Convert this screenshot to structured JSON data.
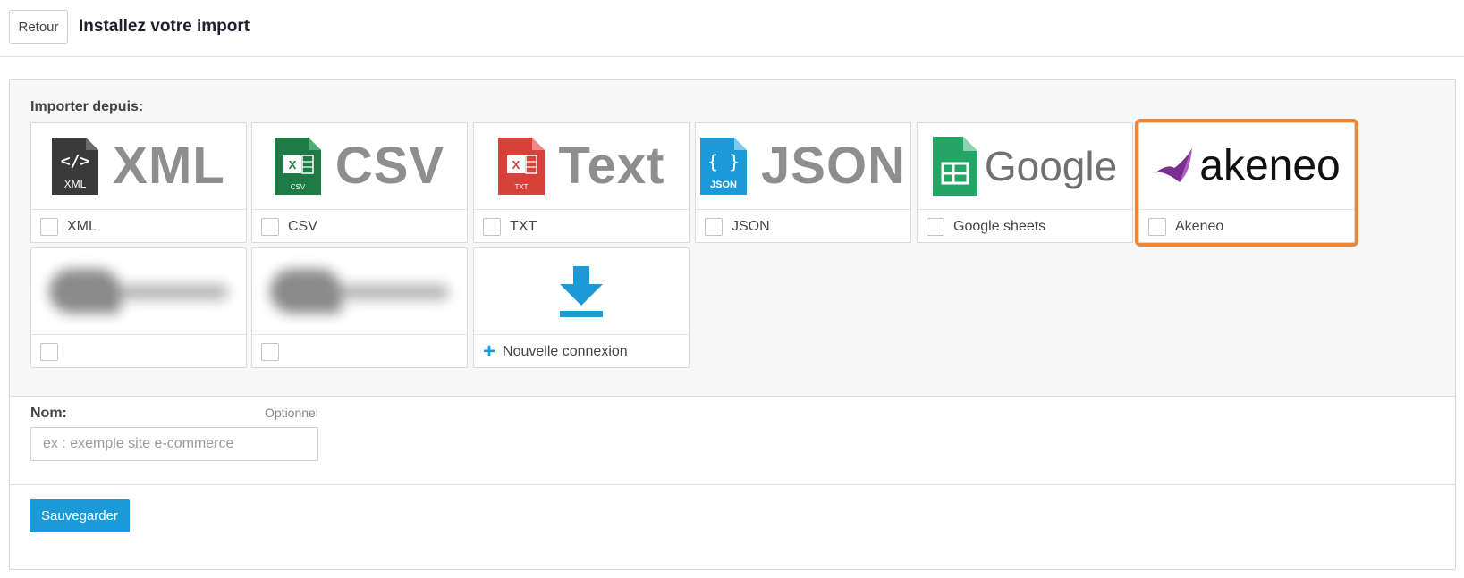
{
  "header": {
    "back_label": "Retour",
    "title": "Installez votre import"
  },
  "sources": {
    "label": "Importer depuis:",
    "cards": [
      {
        "logo_text": "XML",
        "icon_caption": "XML",
        "label": "XML",
        "icon": "xml-file-icon"
      },
      {
        "logo_text": "CSV",
        "icon_caption": "CSV",
        "label": "CSV",
        "icon": "csv-file-icon"
      },
      {
        "logo_text": "Text",
        "icon_caption": "TXT",
        "label": "TXT",
        "icon": "txt-file-icon"
      },
      {
        "logo_text": "JSON",
        "icon_caption": "JSON",
        "label": "JSON",
        "icon": "json-file-icon"
      },
      {
        "logo_text": "Google",
        "label": "Google sheets",
        "icon": "google-sheets-icon"
      },
      {
        "logo_text": "akeneo",
        "label": "Akeneo",
        "icon": "akeneo-logo-icon",
        "highlighted": true
      },
      {
        "label": "",
        "icon": "blurred-logo-icon"
      },
      {
        "label": "",
        "icon": "blurred-logo-icon"
      },
      {
        "label": "Nouvelle connexion",
        "icon": "download-icon"
      }
    ]
  },
  "name": {
    "label": "Nom:",
    "optional": "Optionnel",
    "placeholder": "ex : exemple site e-commerce",
    "value": ""
  },
  "actions": {
    "save_label": "Sauvegarder"
  },
  "colors": {
    "accent": "#1a9ad6",
    "highlight": "#e8863a",
    "csv_green": "#1e7b45",
    "txt_red": "#d8413a",
    "json_blue": "#1a9ad6",
    "sheets_green": "#23a566",
    "akeneo_purple": "#7b2f8e"
  }
}
